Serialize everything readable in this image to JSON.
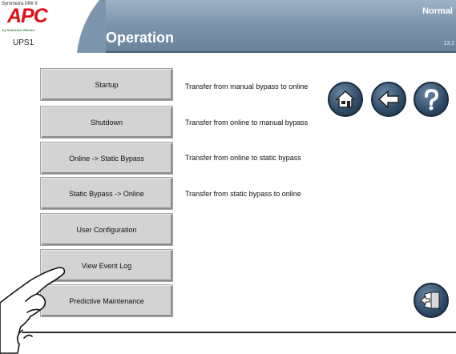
{
  "header": {
    "model": "Symmetra MW II",
    "brand": "APC",
    "brand_sub": "by Schneider Electric",
    "ups_name": "UPS1",
    "title": "Operation",
    "status": "Normal",
    "clock": "13:2"
  },
  "menu": [
    {
      "label": "Startup",
      "description": "Transfer from manual bypass to online"
    },
    {
      "label": "Shutdown",
      "description": "Transfer from online to manual bypass"
    },
    {
      "label": "Online -> Static Bypass",
      "description": "Transfer from online to static bypass"
    },
    {
      "label": "Static Bypass -> Online",
      "description": "Transfer from static bypass to online"
    },
    {
      "label": "User Configuration",
      "description": ""
    },
    {
      "label": "View Event Log",
      "description": ""
    },
    {
      "label": "Predictive Maintenance",
      "description": ""
    }
  ],
  "icons": {
    "home": "home-icon",
    "back": "back-arrow-icon",
    "help": "help-question-icon",
    "exit": "exit-door-icon",
    "pointer": "pointing-hand-icon"
  },
  "colors": {
    "header": "#7e96ad",
    "button": "#d3d3d3",
    "brand_red": "#e0101a",
    "round_button": "#2e4a66"
  }
}
